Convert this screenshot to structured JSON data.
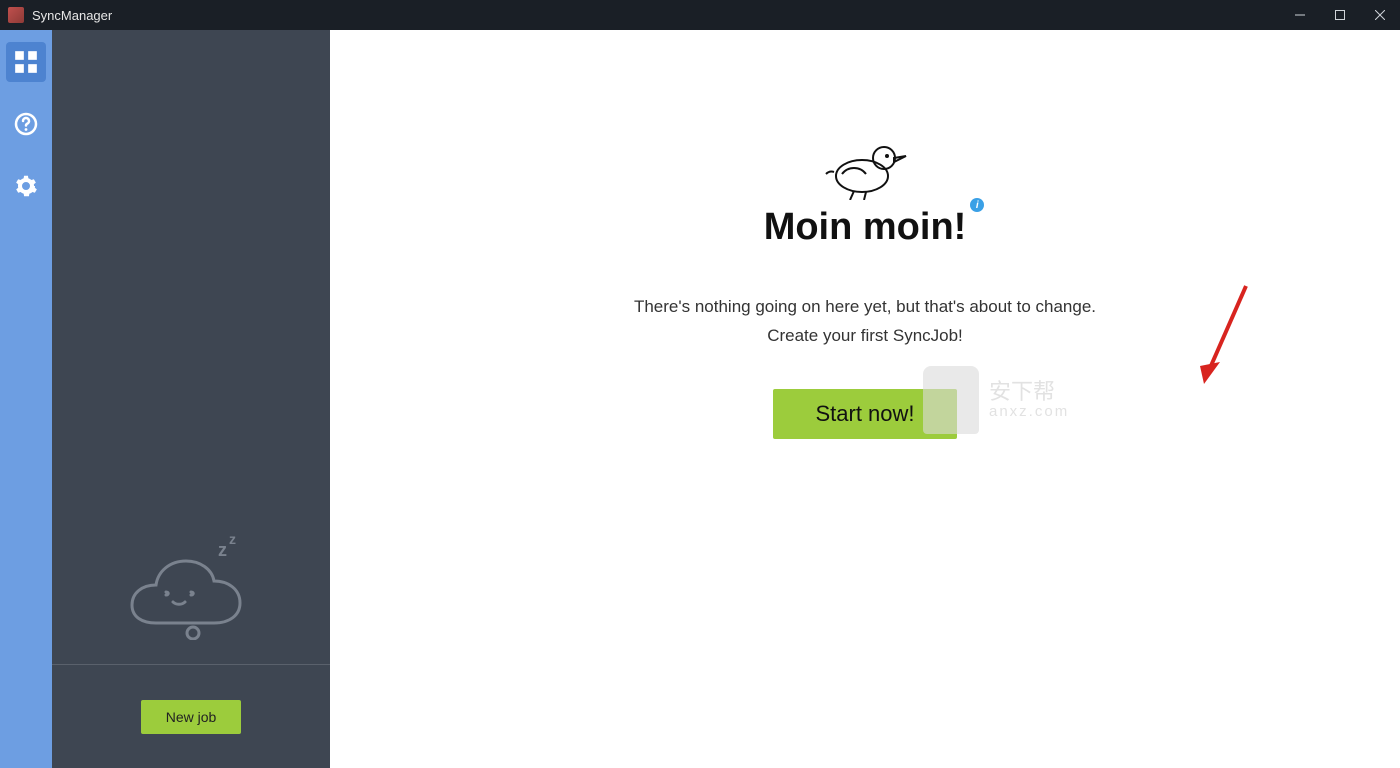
{
  "titlebar": {
    "app_name": "SyncManager"
  },
  "nav": {
    "items": [
      {
        "name": "dashboard",
        "icon": "grid-icon",
        "active": true
      },
      {
        "name": "help",
        "icon": "help-icon",
        "active": false
      },
      {
        "name": "settings",
        "icon": "gear-icon",
        "active": false
      }
    ]
  },
  "job_panel": {
    "new_job_label": "New job"
  },
  "main": {
    "heading": "Moin moin!",
    "info_badge": "i",
    "subtext_line1": "There's nothing going on here yet, but that's about to change.",
    "subtext_line2": "Create your first SyncJob!",
    "start_label": "Start now!"
  },
  "watermark": {
    "line1": "安下帮",
    "line2": "anxz.com"
  },
  "colors": {
    "accent_green": "#9ccc3c",
    "rail_blue": "#6d9ee2",
    "panel_dark": "#3e4652"
  }
}
